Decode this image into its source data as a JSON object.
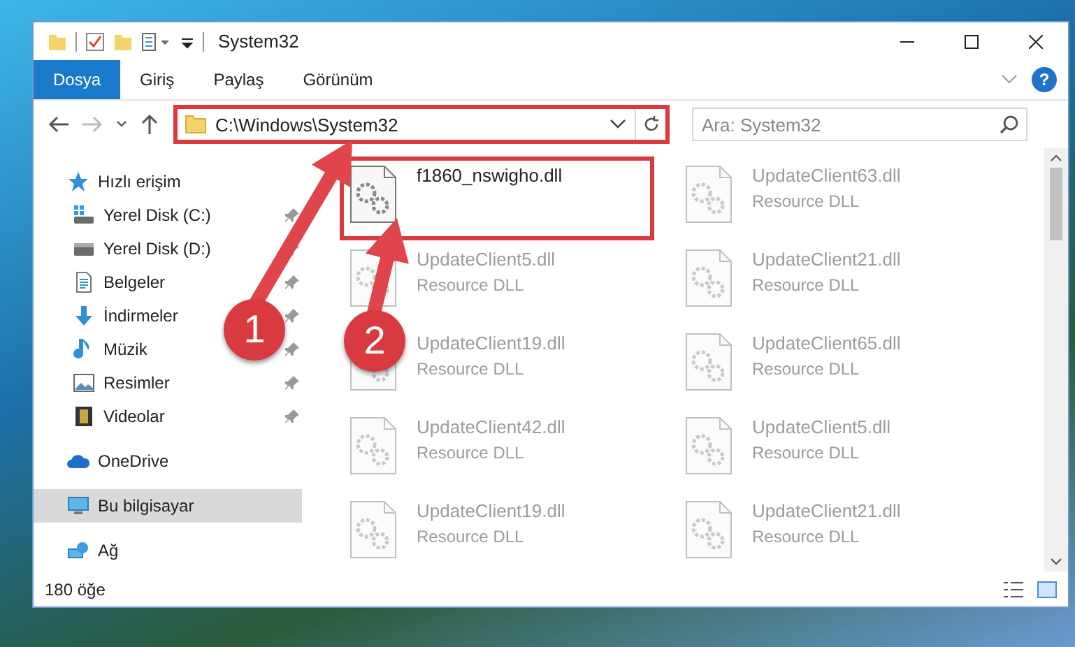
{
  "window": {
    "title": "System32"
  },
  "ribbon": {
    "tabs": [
      {
        "label": "Dosya",
        "selected": true
      },
      {
        "label": "Giriş",
        "selected": false
      },
      {
        "label": "Paylaş",
        "selected": false
      },
      {
        "label": "Görünüm",
        "selected": false
      }
    ],
    "help_button": "?"
  },
  "navigation": {
    "back_disabled": false,
    "forward_disabled": true
  },
  "address_bar": {
    "path": "C:\\Windows\\System32",
    "highlighted": true
  },
  "search": {
    "placeholder": "Ara: System32"
  },
  "sidebar": {
    "items": [
      {
        "label": "Hızlı erişim",
        "kind": "star",
        "selected": false,
        "children": [
          {
            "label": "Yerel Disk (C:)",
            "kind": "drive-c",
            "pinned": true,
            "selected": false
          },
          {
            "label": "Yerel Disk (D:)",
            "kind": "drive",
            "pinned": true,
            "selected": false
          },
          {
            "label": "Belgeler",
            "kind": "document",
            "pinned": true,
            "selected": false
          },
          {
            "label": "İndirmeler",
            "kind": "download",
            "pinned": true,
            "selected": false
          },
          {
            "label": "Müzik",
            "kind": "music",
            "pinned": true,
            "selected": false
          },
          {
            "label": "Resimler",
            "kind": "picture",
            "pinned": true,
            "selected": false
          },
          {
            "label": "Videolar",
            "kind": "film",
            "pinned": true,
            "selected": false
          }
        ]
      },
      {
        "label": "OneDrive",
        "kind": "cloud",
        "selected": false
      },
      {
        "label": "Bu bilgisayar",
        "kind": "computer",
        "selected": true
      },
      {
        "label": "Ağ",
        "kind": "network",
        "selected": false
      }
    ]
  },
  "files": [
    {
      "name": "f1860_nswigho.dll",
      "faded": false,
      "highlighted": true
    },
    {
      "name": "UpdateClient63.dll",
      "type": "Resource DLL",
      "faded": true,
      "highlighted": false
    },
    {
      "name": "UpdateClient5.dll",
      "type": "Resource DLL",
      "faded": true,
      "highlighted": false
    },
    {
      "name": "UpdateClient21.dll",
      "type": "Resource DLL",
      "faded": true,
      "highlighted": false
    },
    {
      "name": "UpdateClient19.dll",
      "type": "Resource DLL",
      "faded": true,
      "highlighted": false
    },
    {
      "name": "UpdateClient65.dll",
      "type": "Resource DLL",
      "faded": true,
      "highlighted": false
    },
    {
      "name": "UpdateClient42.dll",
      "type": "Resource DLL",
      "faded": true,
      "highlighted": false
    },
    {
      "name": "UpdateClient5.dll",
      "type": "Resource DLL",
      "faded": true,
      "highlighted": false
    },
    {
      "name": "UpdateClient19.dll",
      "type": "Resource DLL",
      "faded": true,
      "highlighted": false
    },
    {
      "name": "UpdateClient21.dll",
      "type": "Resource DLL",
      "faded": true,
      "highlighted": false
    }
  ],
  "status_bar": {
    "item_count": "180 öğe"
  },
  "callouts": [
    {
      "number": "1"
    },
    {
      "number": "2"
    }
  ]
}
